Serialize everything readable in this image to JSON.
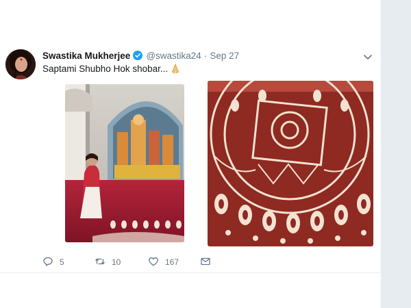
{
  "tweet": {
    "author_name": "Swastika Mukherjee",
    "handle": "@swastika24",
    "separator": "·",
    "time": "Sep 27",
    "text": "Saptami Shubho Hok shobar..."
  },
  "actions": {
    "reply_count": "5",
    "retweet_count": "10",
    "like_count": "167"
  },
  "colors": {
    "verified_blue": "#1da1f2",
    "muted_text": "#657786",
    "rail_background": "#e6ecf0"
  },
  "icons": [
    "verified-badge-icon",
    "caret-down-icon",
    "folded-hands-emoji-icon",
    "reply-icon",
    "retweet-icon",
    "like-icon",
    "direct-message-icon"
  ]
}
